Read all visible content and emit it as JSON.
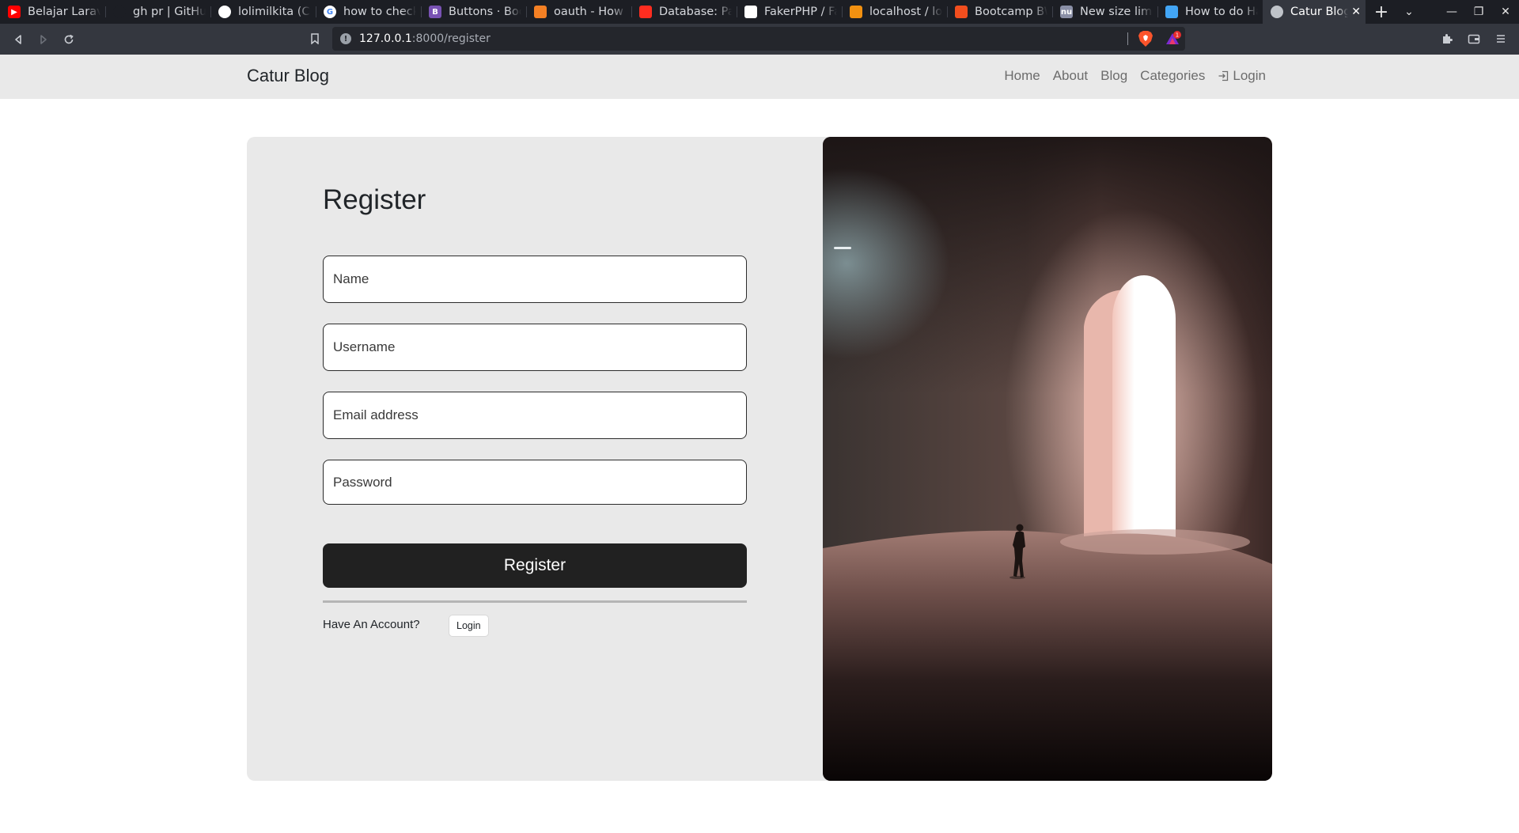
{
  "browser": {
    "tabs": [
      {
        "title": "Belajar Laravel",
        "favicon": "youtube-icon",
        "color": "#ff0000",
        "glyph": "▶"
      },
      {
        "title": "gh pr | GitHub",
        "favicon": "github-icon",
        "color": "#1c1e24",
        "glyph": ""
      },
      {
        "title": "lolimilkita (Ca",
        "favicon": "github-icon",
        "color": "#ffffff",
        "glyph": ""
      },
      {
        "title": "how to check",
        "favicon": "google-icon",
        "color": "#ffffff",
        "glyph": "G"
      },
      {
        "title": "Buttons · Boo",
        "favicon": "bootstrap-icon",
        "color": "#7952b3",
        "glyph": "B"
      },
      {
        "title": "oauth - How t",
        "favicon": "stackoverflow-icon",
        "color": "#f48024",
        "glyph": ""
      },
      {
        "title": "Database: Pag",
        "favicon": "laravel-icon",
        "color": "#ff2d20",
        "glyph": ""
      },
      {
        "title": "FakerPHP / Fa",
        "favicon": "faker-icon",
        "color": "#ffffff",
        "glyph": ""
      },
      {
        "title": "localhost / loc",
        "favicon": "phpmyadmin-icon",
        "color": "#f29111",
        "glyph": ""
      },
      {
        "title": "Bootcamp BW",
        "favicon": "figma-icon",
        "color": "#f24e1e",
        "glyph": ""
      },
      {
        "title": "New size limit",
        "favicon": "nu-icon",
        "color": "#8a8fa6",
        "glyph": "nu"
      },
      {
        "title": "How to do Ha",
        "favicon": "flutter-icon",
        "color": "#42a5f5",
        "glyph": ""
      },
      {
        "title": "Catur Blog",
        "favicon": "globe-icon",
        "color": "#bfc3c9",
        "glyph": "",
        "active": true
      }
    ],
    "url_host": "127.0.0.1",
    "url_path": ":8000/register",
    "rewards_badge": "1"
  },
  "site": {
    "brand": "Catur Blog",
    "nav": {
      "home": "Home",
      "about": "About",
      "blog": "Blog",
      "categories": "Categories",
      "login": "Login"
    }
  },
  "form": {
    "title": "Register",
    "name_placeholder": "Name",
    "username_placeholder": "Username",
    "email_placeholder": "Email address",
    "password_placeholder": "Password",
    "submit_label": "Register",
    "have_account": "Have An Account?",
    "login_label": "Login"
  }
}
